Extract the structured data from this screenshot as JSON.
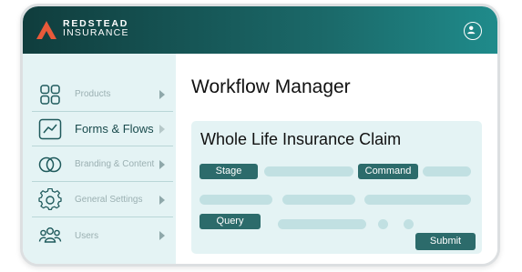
{
  "brand": {
    "line1": "REDSTEAD",
    "line2": "INSURANCE"
  },
  "header": {
    "account_icon": "user-circle-icon"
  },
  "sidebar": {
    "items": [
      {
        "label": "Products",
        "icon": "grid-squares-icon",
        "active": false
      },
      {
        "label": "Forms & Flows",
        "icon": "chart-line-icon",
        "active": true
      },
      {
        "label": "Branding & Content",
        "icon": "overlap-circles-icon",
        "active": false
      },
      {
        "label": "General Settings",
        "icon": "gear-icon",
        "active": false
      },
      {
        "label": "Users",
        "icon": "users-icon",
        "active": false
      }
    ]
  },
  "main": {
    "title": "Workflow Manager",
    "card": {
      "title": "Whole Life Insurance Claim",
      "chips": {
        "stage": "Stage",
        "command": "Command",
        "query": "Query"
      },
      "submit": "Submit"
    }
  },
  "colors": {
    "header_dark": "#103d3d",
    "header_light": "#1f8b8b",
    "accent": "#2c6b6b",
    "logo": "#e85a3a",
    "panel_bg": "#e4f3f4",
    "placeholder": "#c1e0e2"
  }
}
